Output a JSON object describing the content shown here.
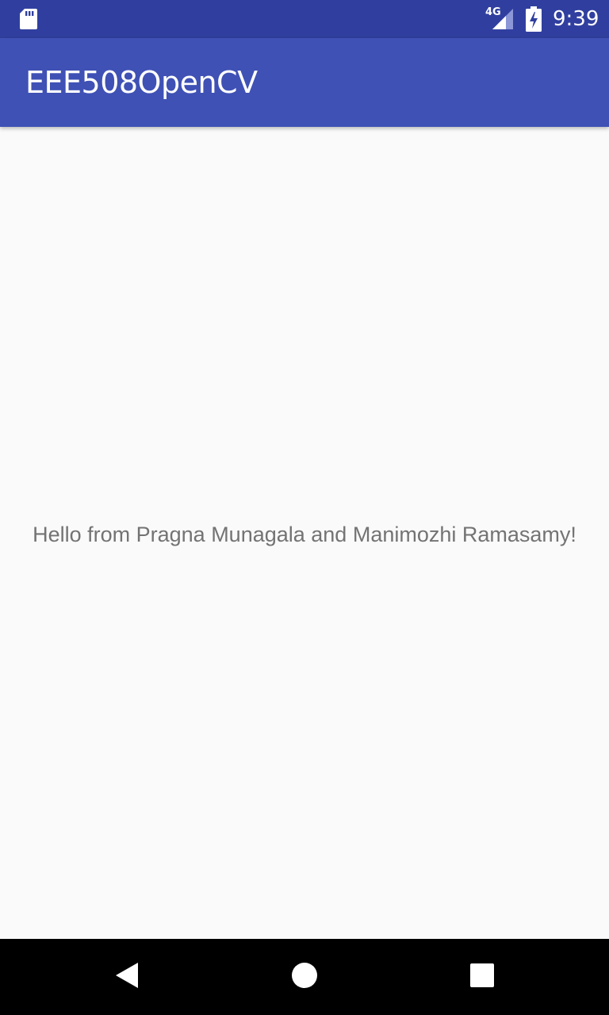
{
  "status_bar": {
    "network_type": "4G",
    "time": "9:39",
    "icons": [
      "sd-card-icon",
      "signal-icon",
      "battery-charging-icon"
    ]
  },
  "app_bar": {
    "title": "EEE508OpenCV",
    "background_color": "#3f51b5"
  },
  "main": {
    "message": "Hello from Pragna Munagala and Manimozhi Ramasamy!"
  },
  "nav_bar": {
    "buttons": [
      "back-icon",
      "home-icon",
      "recents-icon"
    ]
  },
  "colors": {
    "status_bar": "#303f9f",
    "app_bar": "#3f51b5",
    "background": "#fafafa",
    "text": "#737373"
  }
}
